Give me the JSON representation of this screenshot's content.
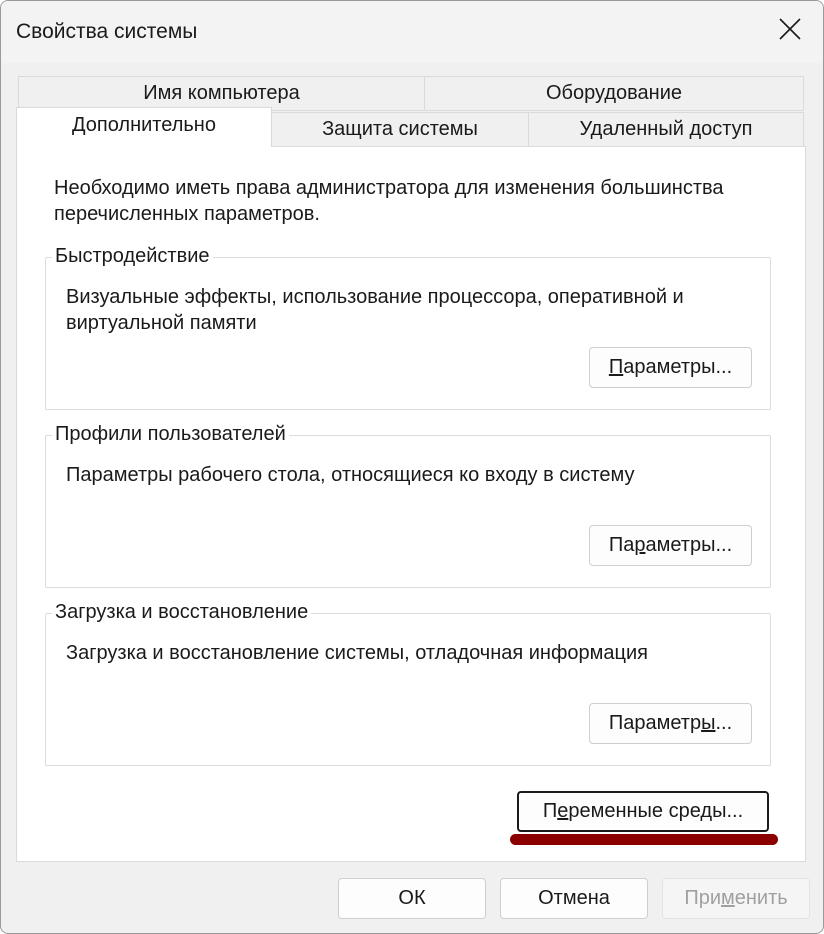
{
  "window": {
    "title": "Свойства системы",
    "close_icon": "close-icon"
  },
  "tabs": {
    "row_back": [
      {
        "label": "Имя компьютера"
      },
      {
        "label": "Оборудование"
      }
    ],
    "row_front": [
      {
        "label": "Дополнительно",
        "active": true
      },
      {
        "label": "Защита системы"
      },
      {
        "label": "Удаленный доступ"
      }
    ]
  },
  "panel": {
    "intro": "Необходимо иметь права администратора для изменения большинства перечисленных параметров.",
    "groups": [
      {
        "title": "Быстродействие",
        "description": "Визуальные эффекты, использование процессора, оперативной и виртуальной памяти",
        "button_pre": "",
        "button_access": "П",
        "button_post": "араметры..."
      },
      {
        "title": "Профили пользователей",
        "description": "Параметры рабочего стола, относящиеся ко входу в систему",
        "button_pre": "Па",
        "button_access": "р",
        "button_post": "аметры..."
      },
      {
        "title": "Загрузка и восстановление",
        "description": "Загрузка и восстановление системы, отладочная информация",
        "button_pre": "Параметр",
        "button_access": "ы",
        "button_post": "..."
      }
    ],
    "env_button": {
      "pre": "П",
      "access": "е",
      "post": "ременные среды...",
      "focused": true,
      "highlight_color": "#8b0000"
    }
  },
  "footer": {
    "ok": "ОК",
    "cancel": "Отмена",
    "apply_pre": "При",
    "apply_access": "м",
    "apply_post": "енить",
    "apply_disabled": true
  }
}
